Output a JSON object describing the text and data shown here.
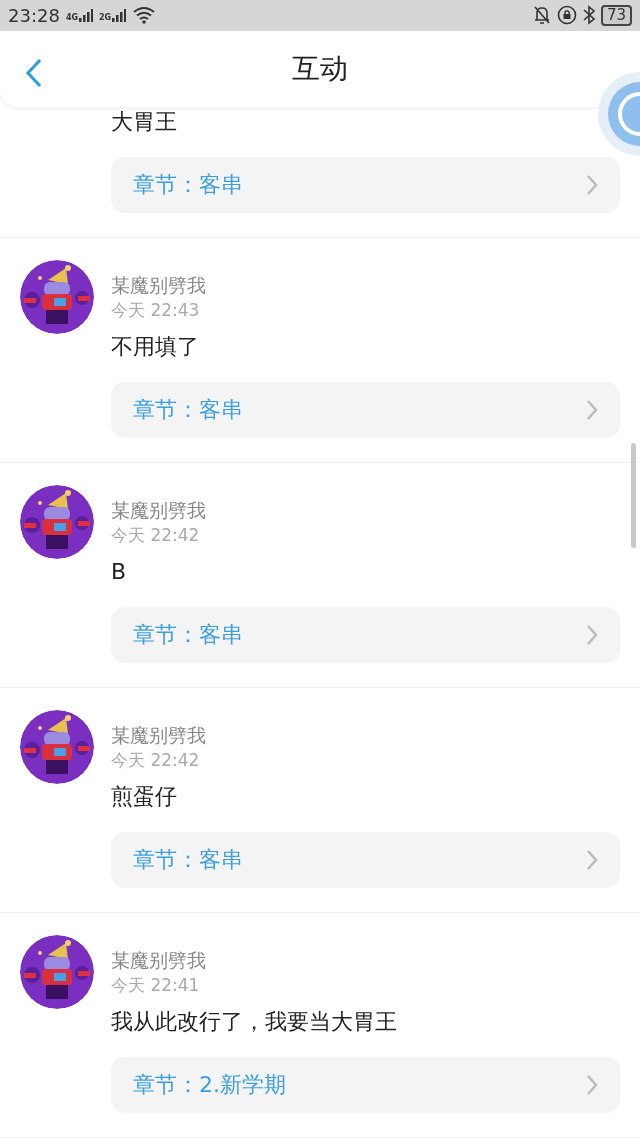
{
  "status_bar": {
    "time": "23:28",
    "signal_1": "4G",
    "signal_2": "2G",
    "battery": "73"
  },
  "header": {
    "title": "互动"
  },
  "comments": [
    {
      "text": "大胃王",
      "chapter": "章节：客串"
    },
    {
      "author": "某魔别劈我",
      "time": "今天 22:43",
      "text": "不用填了",
      "chapter": "章节：客串"
    },
    {
      "author": "某魔别劈我",
      "time": "今天 22:42",
      "text": "B",
      "chapter": "章节：客串"
    },
    {
      "author": "某魔别劈我",
      "time": "今天 22:42",
      "text": "煎蛋仔",
      "chapter": "章节：客串"
    },
    {
      "author": "某魔别劈我",
      "time": "今天 22:41",
      "text": "我从此改行了，我要当大胃王",
      "chapter": "章节：2.新学期"
    }
  ]
}
